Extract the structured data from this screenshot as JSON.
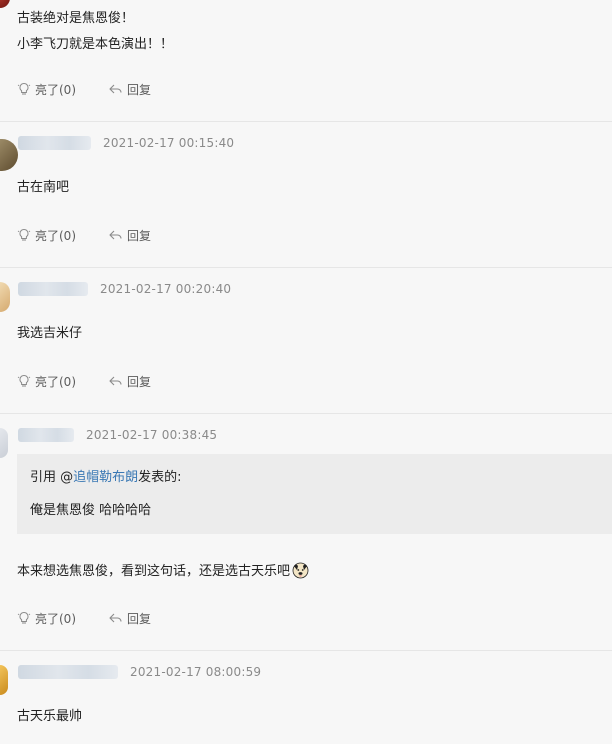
{
  "comments": [
    {
      "username": "",
      "time": "",
      "lines": [
        "古装绝对是焦恩俊！",
        "小李飞刀就是本色演出！！"
      ],
      "like_label": "亮了(0)",
      "reply_label": "回复"
    },
    {
      "username": "",
      "time": "2021-02-17 00:15:40",
      "lines": [
        "古在南吧"
      ],
      "like_label": "亮了(0)",
      "reply_label": "回复"
    },
    {
      "username": "",
      "time": "2021-02-17 00:20:40",
      "lines": [
        "我选吉米仔"
      ],
      "like_label": "亮了(0)",
      "reply_label": "回复"
    },
    {
      "username": "",
      "time": "2021-02-17 00:38:45",
      "quote": {
        "prefix": "引用 @",
        "user": "追帽勒布朗",
        "suffix": "发表的:",
        "text": "俺是焦恩俊 哈哈哈哈"
      },
      "lines": [
        "本来想选焦恩俊，看到这句话，还是选古天乐吧"
      ],
      "like_label": "亮了(0)",
      "reply_label": "回复"
    },
    {
      "username": "",
      "time": "2021-02-17 08:00:59",
      "lines": [
        "古天乐最帅"
      ]
    }
  ],
  "colors": {
    "background": "#f7f7f7",
    "quote_background": "#ececec",
    "link": "#3a78b4",
    "timestamp": "#8a8a8a"
  },
  "icons": {
    "like": "lightbulb-icon",
    "reply": "reply-arrow-icon",
    "emoji": "doge-emoji-icon"
  }
}
